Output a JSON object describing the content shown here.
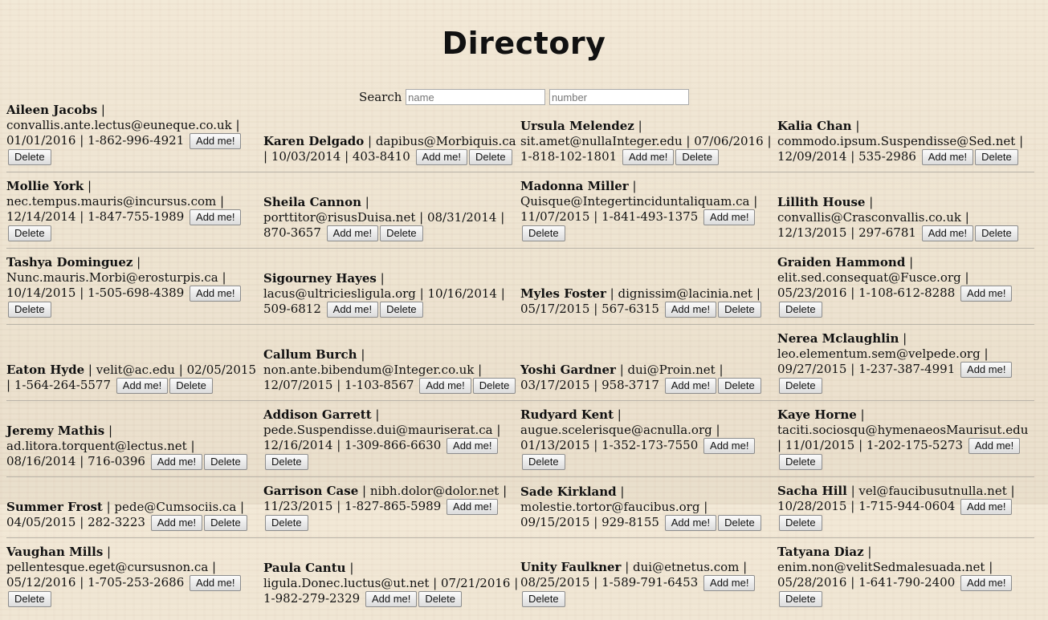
{
  "title": "Directory",
  "search": {
    "label": "Search",
    "name_placeholder": "name",
    "number_placeholder": "number"
  },
  "buttons": {
    "add": "Add me!",
    "delete": "Delete"
  },
  "entries": [
    [
      {
        "name": "Aileen Jacobs",
        "email": "convallis.ante.lectus@euneque.co.uk",
        "date": "01/01/2016",
        "phone": "1-862-996-4921"
      },
      {
        "name": "Karen Delgado",
        "email": "dapibus@Morbiquis.ca",
        "date": "10/03/2014",
        "phone": "403-8410"
      },
      {
        "name": "Ursula Melendez",
        "email": "sit.amet@nullaInteger.edu",
        "date": "07/06/2016",
        "phone": "1-818-102-1801"
      },
      {
        "name": "Kalia Chan",
        "email": "commodo.ipsum.Suspendisse@Sed.net",
        "date": "12/09/2014",
        "phone": "535-2986"
      }
    ],
    [
      {
        "name": "Mollie York",
        "email": "nec.tempus.mauris@incursus.com",
        "date": "12/14/2014",
        "phone": "1-847-755-1989"
      },
      {
        "name": "Sheila Cannon",
        "email": "porttitor@risusDuisa.net",
        "date": "08/31/2014",
        "phone": "870-3657"
      },
      {
        "name": "Madonna Miller",
        "email": "Quisque@Integertinciduntaliquam.ca",
        "date": "11/07/2015",
        "phone": "1-841-493-1375"
      },
      {
        "name": "Lillith House",
        "email": "convallis@Crasconvallis.co.uk",
        "date": "12/13/2015",
        "phone": "297-6781"
      }
    ],
    [
      {
        "name": "Tashya Dominguez",
        "email": "Nunc.mauris.Morbi@erosturpis.ca",
        "date": "10/14/2015",
        "phone": "1-505-698-4389"
      },
      {
        "name": "Sigourney Hayes",
        "email": "lacus@ultriciesligula.org",
        "date": "10/16/2014",
        "phone": "509-6812"
      },
      {
        "name": "Myles Foster",
        "email": "dignissim@lacinia.net",
        "date": "05/17/2015",
        "phone": "567-6315"
      },
      {
        "name": "Graiden Hammond",
        "email": "elit.sed.consequat@Fusce.org",
        "date": "05/23/2016",
        "phone": "1-108-612-8288"
      }
    ],
    [
      {
        "name": "Eaton Hyde",
        "email": "velit@ac.edu",
        "date": "02/05/2015",
        "phone": "1-564-264-5577"
      },
      {
        "name": "Callum Burch",
        "email": "non.ante.bibendum@Integer.co.uk",
        "date": "12/07/2015",
        "phone": "1-103-8567"
      },
      {
        "name": "Yoshi Gardner",
        "email": "dui@Proin.net",
        "date": "03/17/2015",
        "phone": "958-3717"
      },
      {
        "name": "Nerea Mclaughlin",
        "email": "leo.elementum.sem@velpede.org",
        "date": "09/27/2015",
        "phone": "1-237-387-4991"
      }
    ],
    [
      {
        "name": "Jeremy Mathis",
        "email": "ad.litora.torquent@lectus.net",
        "date": "08/16/2014",
        "phone": "716-0396"
      },
      {
        "name": "Addison Garrett",
        "email": "pede.Suspendisse.dui@mauriserat.ca",
        "date": "12/16/2014",
        "phone": "1-309-866-6630"
      },
      {
        "name": "Rudyard Kent",
        "email": "augue.scelerisque@acnulla.org",
        "date": "01/13/2015",
        "phone": "1-352-173-7550"
      },
      {
        "name": "Kaye Horne",
        "email": "taciti.sociosqu@hymenaeosMaurisut.edu",
        "date": "11/01/2015",
        "phone": "1-202-175-5273"
      }
    ],
    [
      {
        "name": "Summer Frost",
        "email": "pede@Cumsociis.ca",
        "date": "04/05/2015",
        "phone": "282-3223"
      },
      {
        "name": "Garrison Case",
        "email": "nibh.dolor@dolor.net",
        "date": "11/23/2015",
        "phone": "1-827-865-5989"
      },
      {
        "name": "Sade Kirkland",
        "email": "molestie.tortor@faucibus.org",
        "date": "09/15/2015",
        "phone": "929-8155"
      },
      {
        "name": "Sacha Hill",
        "email": "vel@faucibusutnulla.net",
        "date": "10/28/2015",
        "phone": "1-715-944-0604"
      }
    ],
    [
      {
        "name": "Vaughan Mills",
        "email": "pellentesque.eget@cursusnon.ca",
        "date": "05/12/2016",
        "phone": "1-705-253-2686"
      },
      {
        "name": "Paula Cantu",
        "email": "ligula.Donec.luctus@ut.net",
        "date": "07/21/2016",
        "phone": "1-982-279-2329"
      },
      {
        "name": "Unity Faulkner",
        "email": "dui@etnetus.com",
        "date": "08/25/2015",
        "phone": "1-589-791-6453"
      },
      {
        "name": "Tatyana Diaz",
        "email": "enim.non@velitSedmalesuada.net",
        "date": "05/28/2016",
        "phone": "1-641-790-2400"
      }
    ]
  ]
}
